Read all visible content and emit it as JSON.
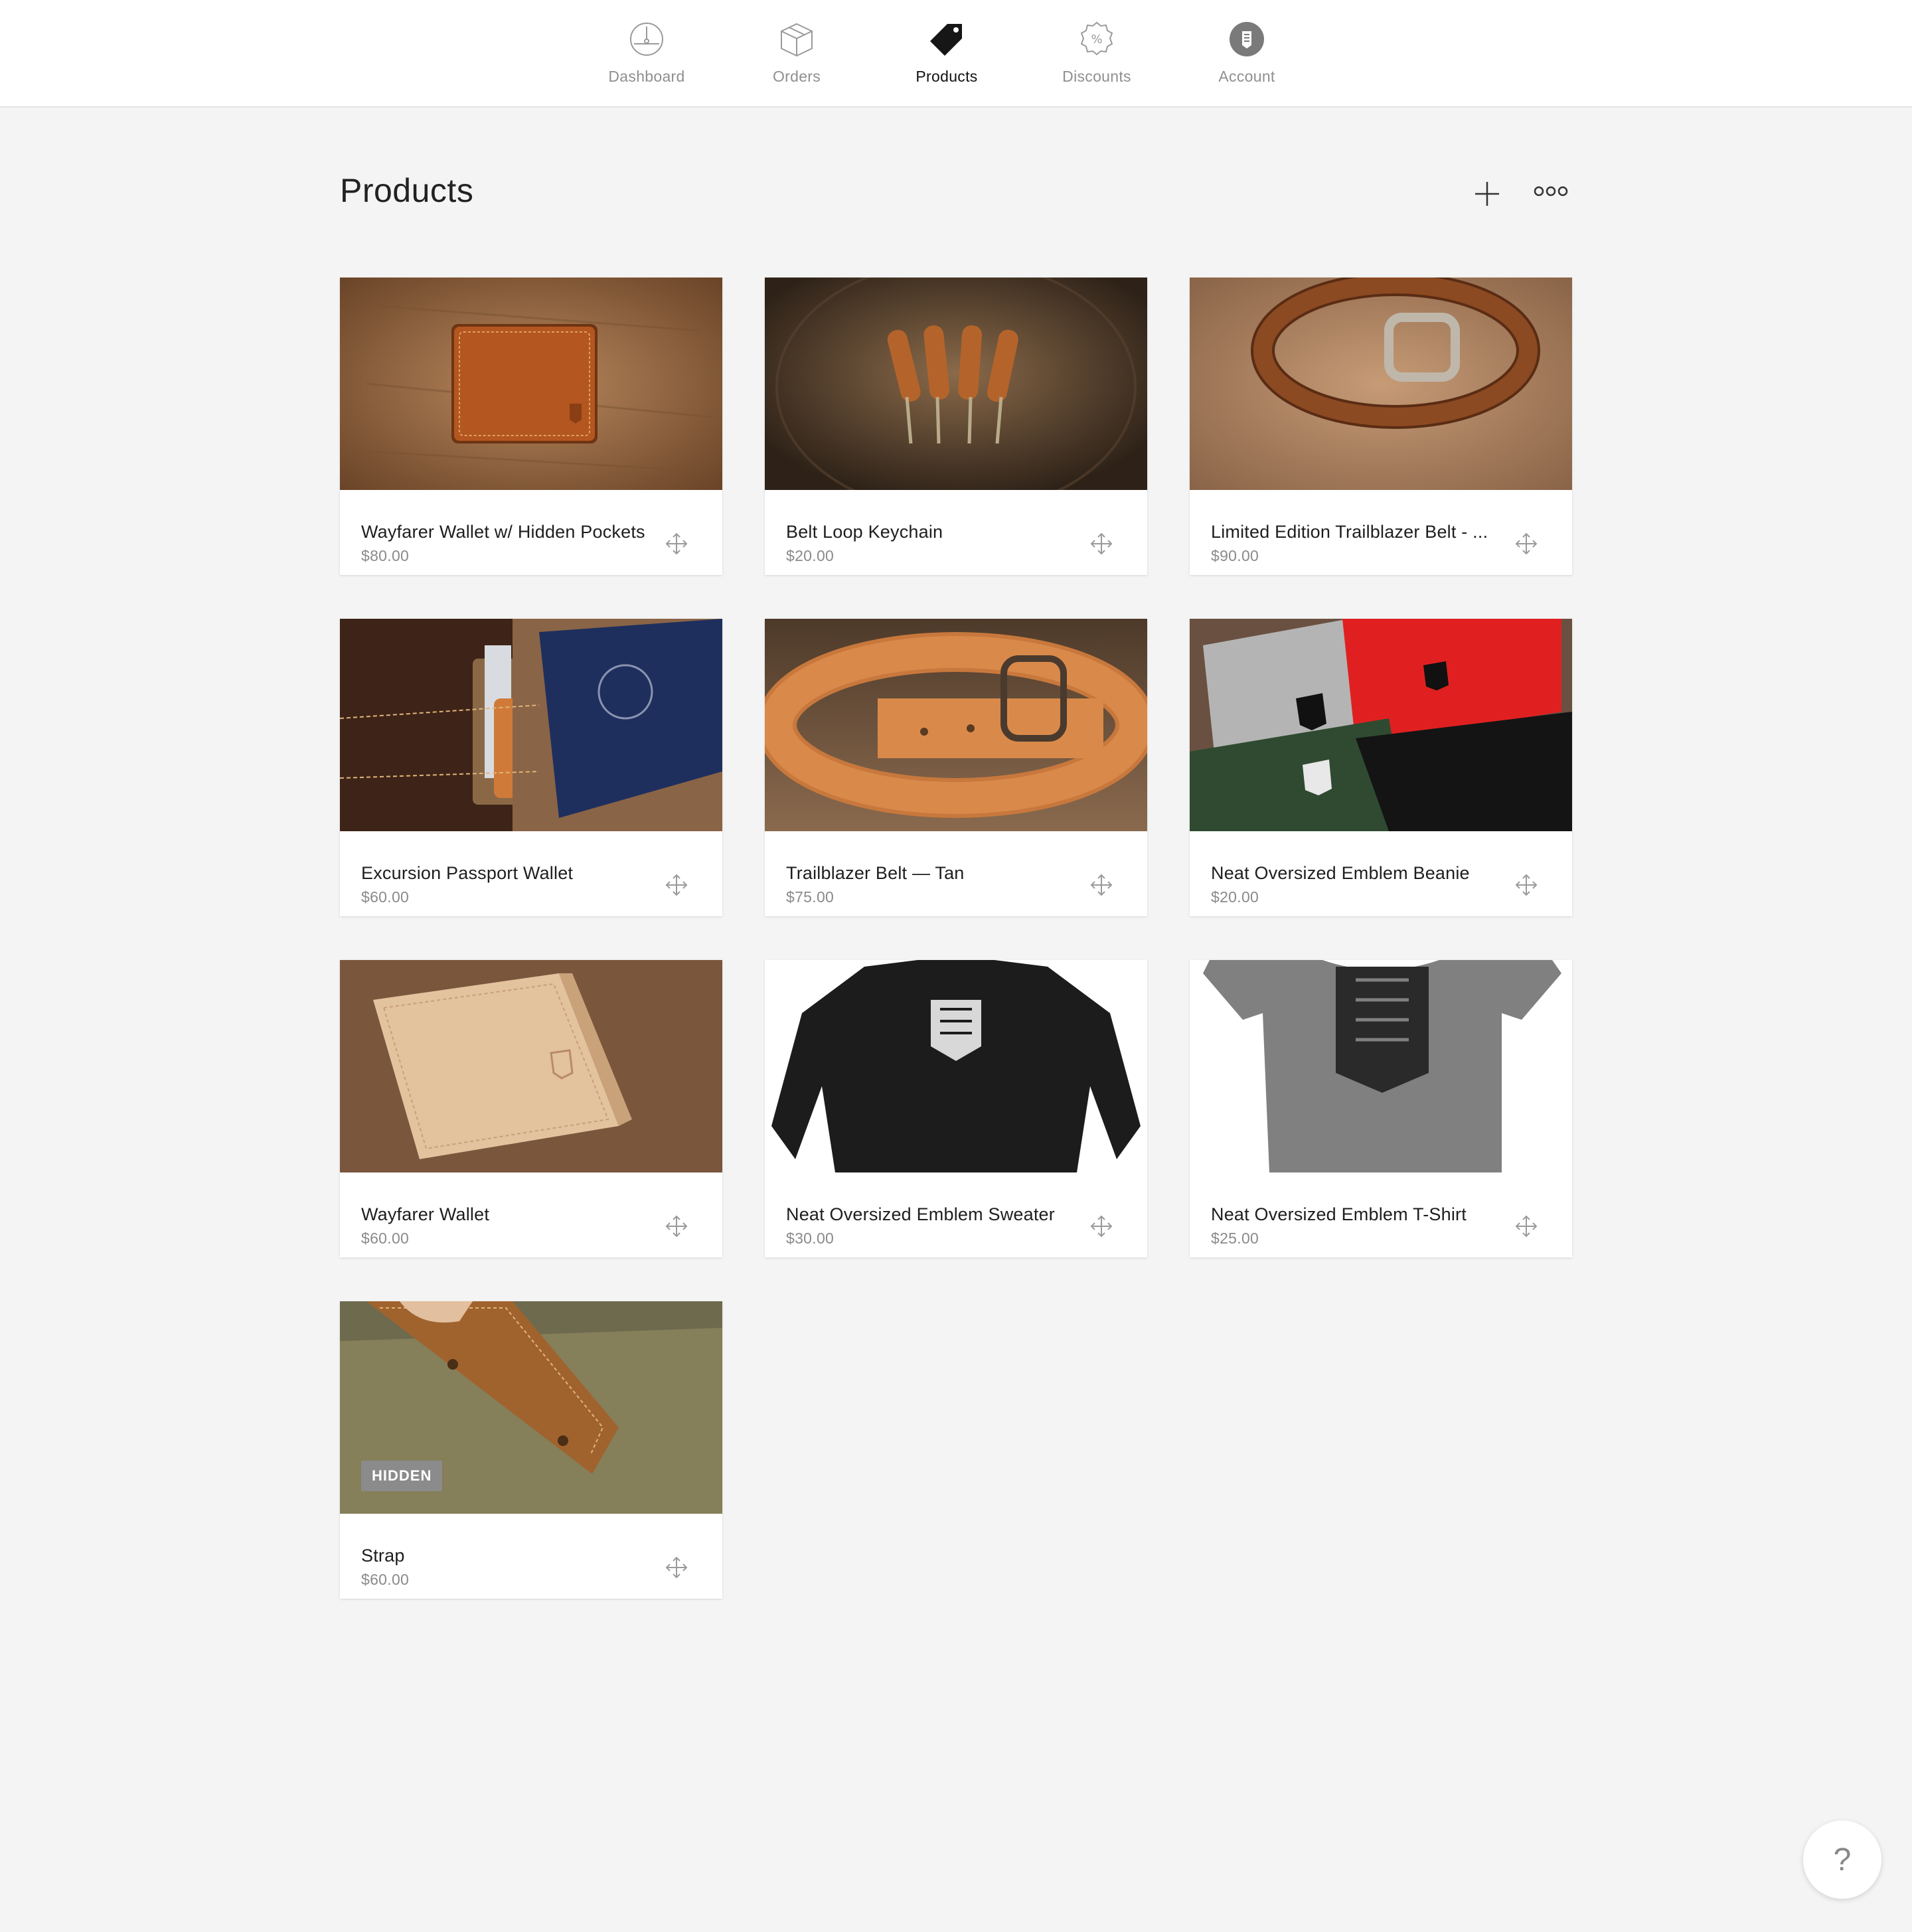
{
  "nav": {
    "items": [
      {
        "label": "Dashboard",
        "icon": "dashboard-icon",
        "active": false
      },
      {
        "label": "Orders",
        "icon": "box-icon",
        "active": false
      },
      {
        "label": "Products",
        "icon": "tag-icon",
        "active": true
      },
      {
        "label": "Discounts",
        "icon": "percent-badge-icon",
        "active": false
      },
      {
        "label": "Account",
        "icon": "account-avatar-icon",
        "active": false
      }
    ]
  },
  "header": {
    "title": "Products",
    "add_icon": "plus-icon",
    "more_icon": "more-dots-icon"
  },
  "products": [
    {
      "name": "Wayfarer Wallet w/ Hidden Pockets",
      "price": "$80.00"
    },
    {
      "name": "Belt Loop Keychain",
      "price": "$20.00"
    },
    {
      "name": "Limited Edition Trailblazer Belt - ...",
      "price": "$90.00"
    },
    {
      "name": "Excursion Passport Wallet",
      "price": "$60.00"
    },
    {
      "name": "Trailblazer Belt — Tan",
      "price": "$75.00"
    },
    {
      "name": "Neat Oversized Emblem Beanie",
      "price": "$20.00"
    },
    {
      "name": "Wayfarer Wallet",
      "price": "$60.00"
    },
    {
      "name": "Neat Oversized Emblem Sweater",
      "price": "$30.00"
    },
    {
      "name": "Neat Oversized Emblem T-Shirt",
      "price": "$25.00"
    },
    {
      "name": "Strap",
      "price": "$60.00",
      "badge": "HIDDEN"
    }
  ],
  "help": {
    "label": "?"
  },
  "colors": {
    "page_bg": "#f4f4f4",
    "card_bg": "#ffffff",
    "badge_bg": "#8b8b8b",
    "muted_text": "#8a8a8a"
  }
}
